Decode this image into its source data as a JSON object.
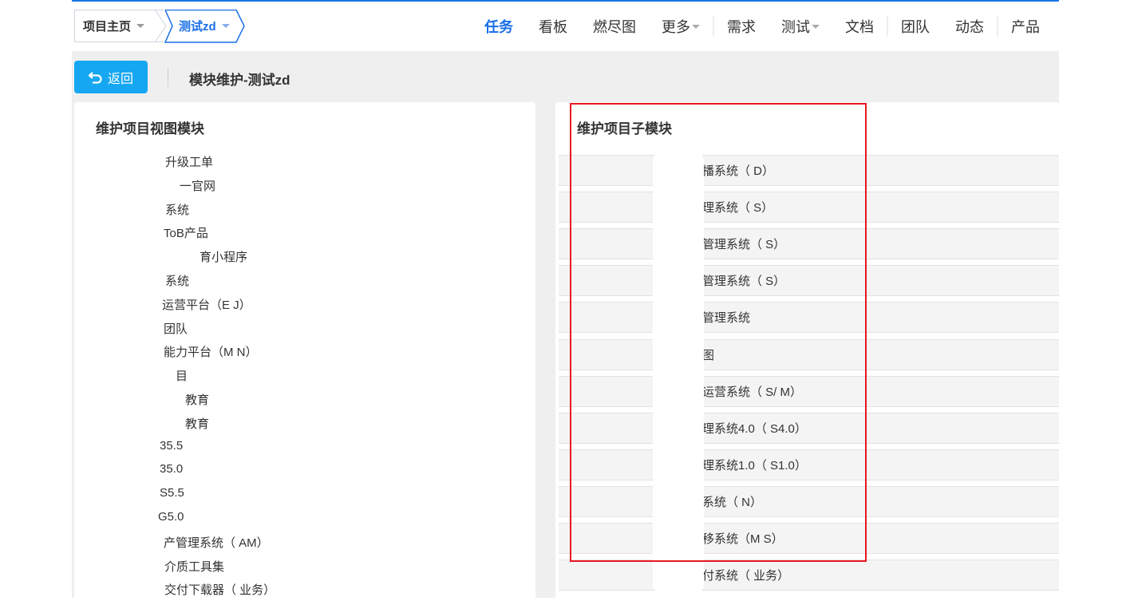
{
  "breadcrumb": {
    "home": "项目主页",
    "project": "测试zd"
  },
  "nav": {
    "items": [
      "任务",
      "看板",
      "燃尽图",
      "更多",
      "需求",
      "测试",
      "文档",
      "团队",
      "动态",
      "产品"
    ],
    "active": "任务"
  },
  "toolbar": {
    "back_label": "返回",
    "page_title": "模块维护-测试zd"
  },
  "left_panel": {
    "title": "维护项目视图模块",
    "items": [
      "升级工单",
      "一官网",
      "系统",
      "ToB产品",
      "育小程序",
      "系统",
      "运营平台（E  J）",
      "团队",
      "能力平台（M  N）",
      "目",
      "教育",
      "教育",
      "35.5",
      "35.0",
      "S5.5",
      "G5.0",
      "产管理系统（  AM）",
      "介质工具集",
      "交付下载器（  业务）"
    ]
  },
  "right_panel": {
    "title": "维护项目子模块",
    "items": [
      "播系统（  D）",
      "理系统（  S）",
      "管理系统（  S）",
      "管理系统（  S）",
      "管理系统",
      "图",
      "运营系统（  S/  M）",
      "理系统4.0（  S4.0）",
      "理系统1.0（  S1.0）",
      "系统（  N）",
      "移系统（M  S）",
      "付系统（  业务）"
    ]
  },
  "colors": {
    "accent": "#1a6fe8",
    "button": "#16a7f2",
    "highlight": "#e8181f"
  }
}
